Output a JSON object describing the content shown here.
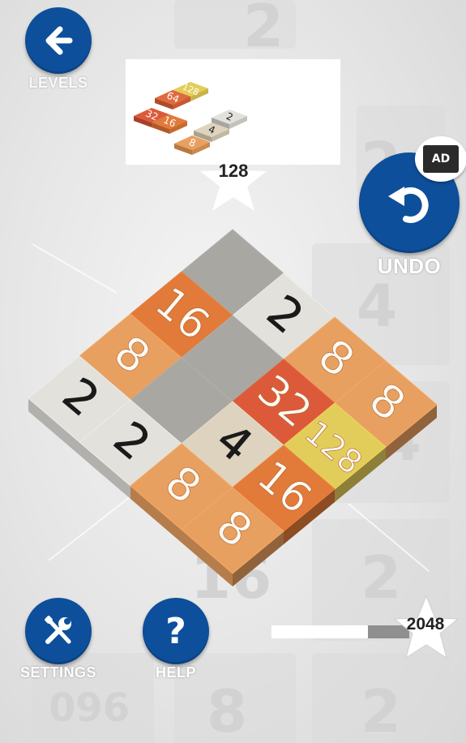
{
  "nav": {
    "levels_label": "LEVELS",
    "undo_label": "UNDO",
    "ad_label": "AD",
    "settings_label": "SETTINGS",
    "help_label": "HELP",
    "help_glyph": "?"
  },
  "goal": {
    "value": "128",
    "preview_tiles": [
      "128",
      "64",
      "32",
      "16",
      "8",
      "4",
      "2"
    ]
  },
  "progress": {
    "target": "2048",
    "fraction": 0.7
  },
  "board": {
    "tiles": [
      {
        "label": "",
        "kind": "empty"
      },
      {
        "label": "2",
        "kind": "t2"
      },
      {
        "label": "8",
        "kind": "t8"
      },
      {
        "label": "8",
        "kind": "t8"
      },
      {
        "label": "16",
        "kind": "t16"
      },
      {
        "label": "",
        "kind": "empty"
      },
      {
        "label": "32",
        "kind": "t32"
      },
      {
        "label": "128",
        "kind": "t128"
      },
      {
        "label": "8",
        "kind": "t8"
      },
      {
        "label": "",
        "kind": "empty"
      },
      {
        "label": "4",
        "kind": "t4"
      },
      {
        "label": "16",
        "kind": "t16"
      },
      {
        "label": "2",
        "kind": "t2"
      },
      {
        "label": "2",
        "kind": "t2"
      },
      {
        "label": "8",
        "kind": "t8"
      },
      {
        "label": "8",
        "kind": "t8"
      }
    ]
  },
  "background_numbers": [
    "4",
    "2",
    "4",
    "2",
    "16",
    "2",
    "8",
    "2",
    "2",
    "096"
  ],
  "colors": {
    "button_blue": "#0d4f9b",
    "t2": "#e3e1dc",
    "t4": "#ddd3be",
    "t8": "#e8a060",
    "t16": "#e27a3a",
    "t32": "#dc5a3a",
    "t64": "#e06a40",
    "t128": "#e3cd5a",
    "empty": "#a9a7a2"
  }
}
